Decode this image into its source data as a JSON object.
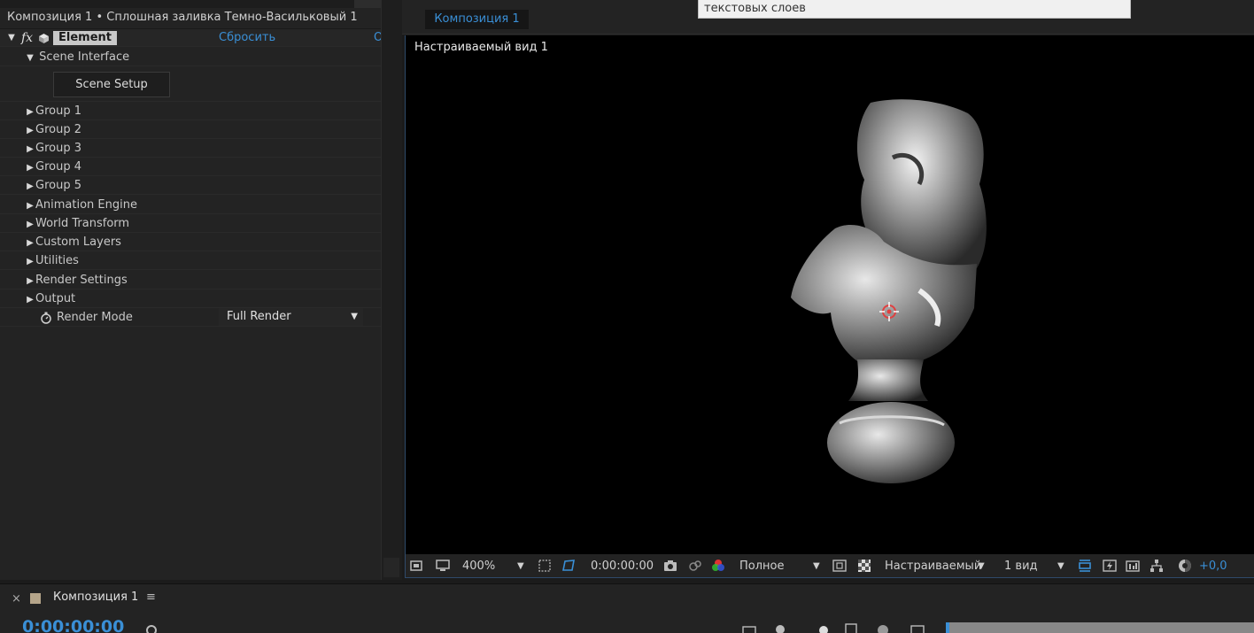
{
  "effect_controls": {
    "title": "Композиция 1 • Сплошная заливка Темно-Васильковый 1",
    "effect_name": "Element",
    "reset_label": "Сбросить",
    "about_label": "О",
    "scene_interface_label": "Scene Interface",
    "scene_setup_button": "Scene Setup",
    "groups": [
      "Group 1",
      "Group 2",
      "Group 3",
      "Group 4",
      "Group 5",
      "Animation Engine",
      "World Transform",
      "Custom Layers",
      "Utilities",
      "Render Settings",
      "Output"
    ],
    "render_mode_label": "Render Mode",
    "render_mode_value": "Full Render"
  },
  "viewer": {
    "tab_label": "Композиция 1",
    "tooltip_text": "текстовых слоев",
    "view_label": "Настраиваемый вид 1"
  },
  "viewer_toolbar": {
    "zoom": "400%",
    "timecode": "0:00:00:00",
    "resolution": "Полное",
    "view_mode": "Настраиваемый",
    "view_count": "1 вид",
    "exposure": "+0,0"
  },
  "timeline": {
    "tab_label": "Композиция 1",
    "timecode": "0:00:00:00"
  },
  "colors": {
    "accent_blue": "#3a8fd6",
    "panel_bg": "#232323",
    "viewer_bg": "#000000"
  }
}
